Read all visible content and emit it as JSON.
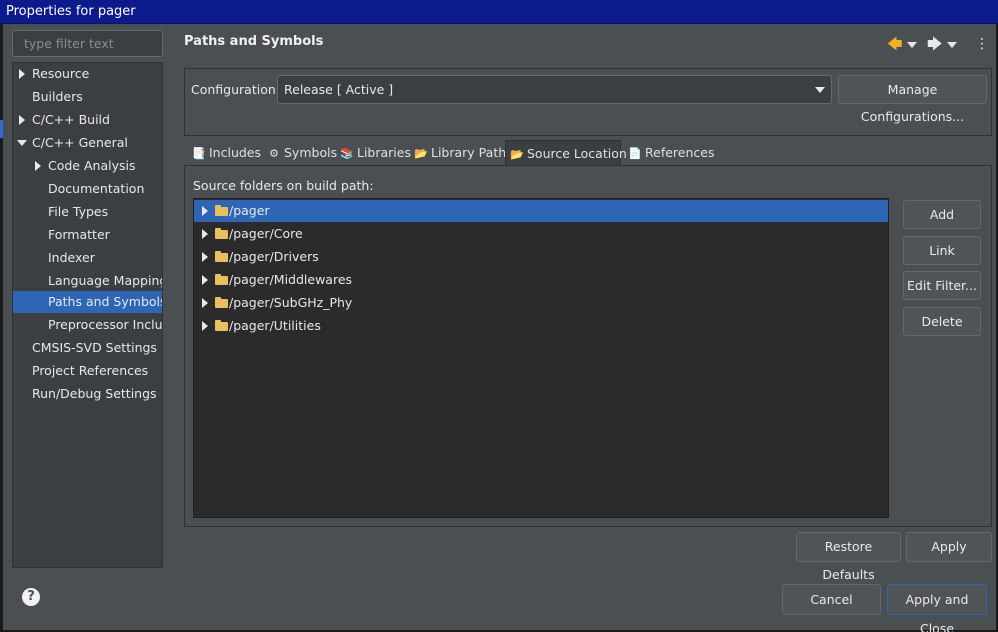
{
  "window": {
    "title": "Properties for pager"
  },
  "filter": {
    "placeholder": "type filter text"
  },
  "tree": {
    "items": [
      {
        "label": "Resource",
        "expand": "collapsed"
      },
      {
        "label": "Builders",
        "expand": "none"
      },
      {
        "label": "C/C++ Build",
        "expand": "collapsed"
      },
      {
        "label": "C/C++ General",
        "expand": "expanded"
      },
      {
        "label": "Code Analysis",
        "expand": "collapsed"
      },
      {
        "label": "Documentation",
        "expand": "none"
      },
      {
        "label": "File Types",
        "expand": "none"
      },
      {
        "label": "Formatter",
        "expand": "none"
      },
      {
        "label": "Indexer",
        "expand": "none"
      },
      {
        "label": "Language Mappings",
        "expand": "none"
      },
      {
        "label": "Paths and Symbols",
        "expand": "none",
        "selected": true
      },
      {
        "label": "Preprocessor Include",
        "expand": "none"
      },
      {
        "label": "CMSIS-SVD Settings",
        "expand": "none"
      },
      {
        "label": "Project References",
        "expand": "none"
      },
      {
        "label": "Run/Debug Settings",
        "expand": "none"
      }
    ]
  },
  "page": {
    "title": "Paths and Symbols"
  },
  "nav": {
    "back_icon": "back-arrow-icon",
    "forward_icon": "forward-arrow-icon",
    "menu_icon": "view-menu-icon",
    "back_glyph": "🡄",
    "forward_glyph": "🡆",
    "menu_glyph": "⋮"
  },
  "config": {
    "label": "Configuration:",
    "value": "Release  [ Active ]",
    "manage_label": "Manage Configurations..."
  },
  "tabs": [
    {
      "label": "Includes",
      "icon": "includes-icon",
      "glyph": "📑"
    },
    {
      "label": "Symbols",
      "icon": "symbols-icon",
      "glyph": "⚙"
    },
    {
      "label": "Libraries",
      "icon": "libraries-icon",
      "glyph": "📚"
    },
    {
      "label": "Library Paths",
      "icon": "library-paths-icon",
      "glyph": "📂"
    },
    {
      "label": "Source Location",
      "icon": "source-location-icon",
      "glyph": "📂",
      "active": true
    },
    {
      "label": "References",
      "icon": "references-icon",
      "glyph": "📄"
    }
  ],
  "source": {
    "label": "Source folders on build path:",
    "folders": [
      "/pager",
      "/pager/Core",
      "/pager/Drivers",
      "/pager/Middlewares",
      "/pager/SubGHz_Phy",
      "/pager/Utilities"
    ],
    "buttons": {
      "add_folder": "Add Folder...",
      "link_folder": "Link Folder...",
      "edit_filter": "Edit Filter...",
      "delete": "Delete"
    }
  },
  "footer": {
    "restore_defaults": "Restore Defaults",
    "apply": "Apply",
    "cancel": "Cancel",
    "apply_close": "Apply and Close",
    "help_glyph": "?"
  },
  "colors": {
    "accent": "#2e65b4",
    "titlebar": "#0d1a8c",
    "background": "#4b4f52",
    "list_background": "#2b2b2b"
  }
}
